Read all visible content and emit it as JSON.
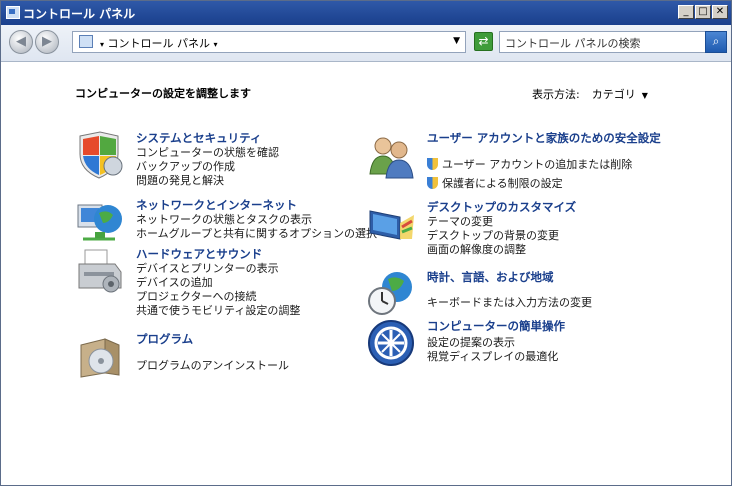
{
  "window": {
    "title": "コントロール パネル"
  },
  "address": {
    "crumb": "コントロール パネル"
  },
  "search": {
    "placeholder": "コントロール パネルの検索"
  },
  "heading": "コンピューターの設定を調整します",
  "view_by": {
    "label": "表示方法:",
    "value": "カテゴリ"
  },
  "categories": [
    {
      "title": "システムとセキュリティ",
      "links": [
        "コンピューターの状態を確認",
        "バックアップの作成",
        "問題の発見と解決"
      ]
    },
    {
      "title": "ネットワークとインターネット",
      "links": [
        "ネットワークの状態とタスクの表示",
        "ホームグループと共有に関するオプションの選択"
      ]
    },
    {
      "title": "ハードウェアとサウンド",
      "links": [
        "デバイスとプリンターの表示",
        "デバイスの追加",
        "プロジェクターへの接続",
        "共通で使うモビリティ設定の調整"
      ]
    },
    {
      "title": "プログラム",
      "links": [
        "プログラムのアンインストール"
      ]
    },
    {
      "title": "ユーザー アカウントと家族のための安全設定",
      "links": [
        "ユーザー アカウントの追加または削除",
        "保護者による制限の設定"
      ]
    },
    {
      "title": "デスクトップのカスタマイズ",
      "links": [
        "テーマの変更",
        "デスクトップの背景の変更",
        "画面の解像度の調整"
      ]
    },
    {
      "title": "時計、言語、および地域",
      "links": [
        "キーボードまたは入力方法の変更"
      ]
    },
    {
      "title": "コンピューターの簡単操作",
      "links": [
        "設定の提案の表示",
        "視覚ディスプレイの最適化"
      ]
    }
  ]
}
